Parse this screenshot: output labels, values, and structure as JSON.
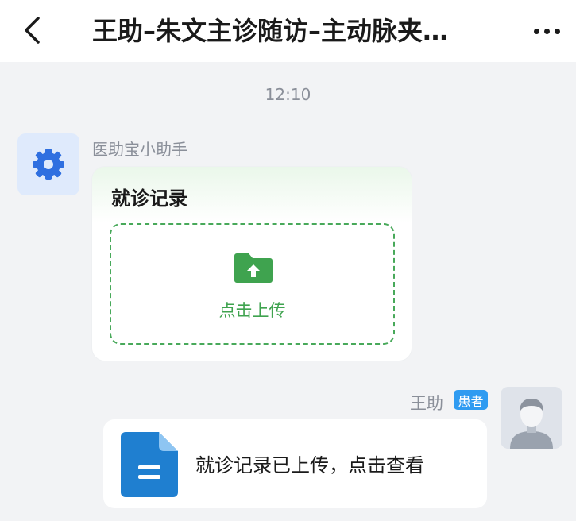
{
  "header": {
    "back_icon": "chevron-left-icon",
    "title": "王助–朱文主诊随访–主动脉夹…",
    "more_icon": "more-horizontal-icon"
  },
  "conversation": {
    "timestamp": "12:10",
    "assistant_message": {
      "sender": "医助宝小助手",
      "avatar_icon": "gear-icon",
      "card_title": "就诊记录",
      "upload_icon": "folder-upload-icon",
      "upload_label": "点击上传"
    },
    "patient_message": {
      "sender": "王助",
      "badge": "患者",
      "avatar_icon": "user-avatar-icon",
      "file_icon": "document-icon",
      "text": "就诊记录已上传，点击查看"
    }
  },
  "colors": {
    "accent_green": "#3fa34f",
    "accent_blue": "#2f9bf1",
    "background": "#f2f3f5"
  }
}
